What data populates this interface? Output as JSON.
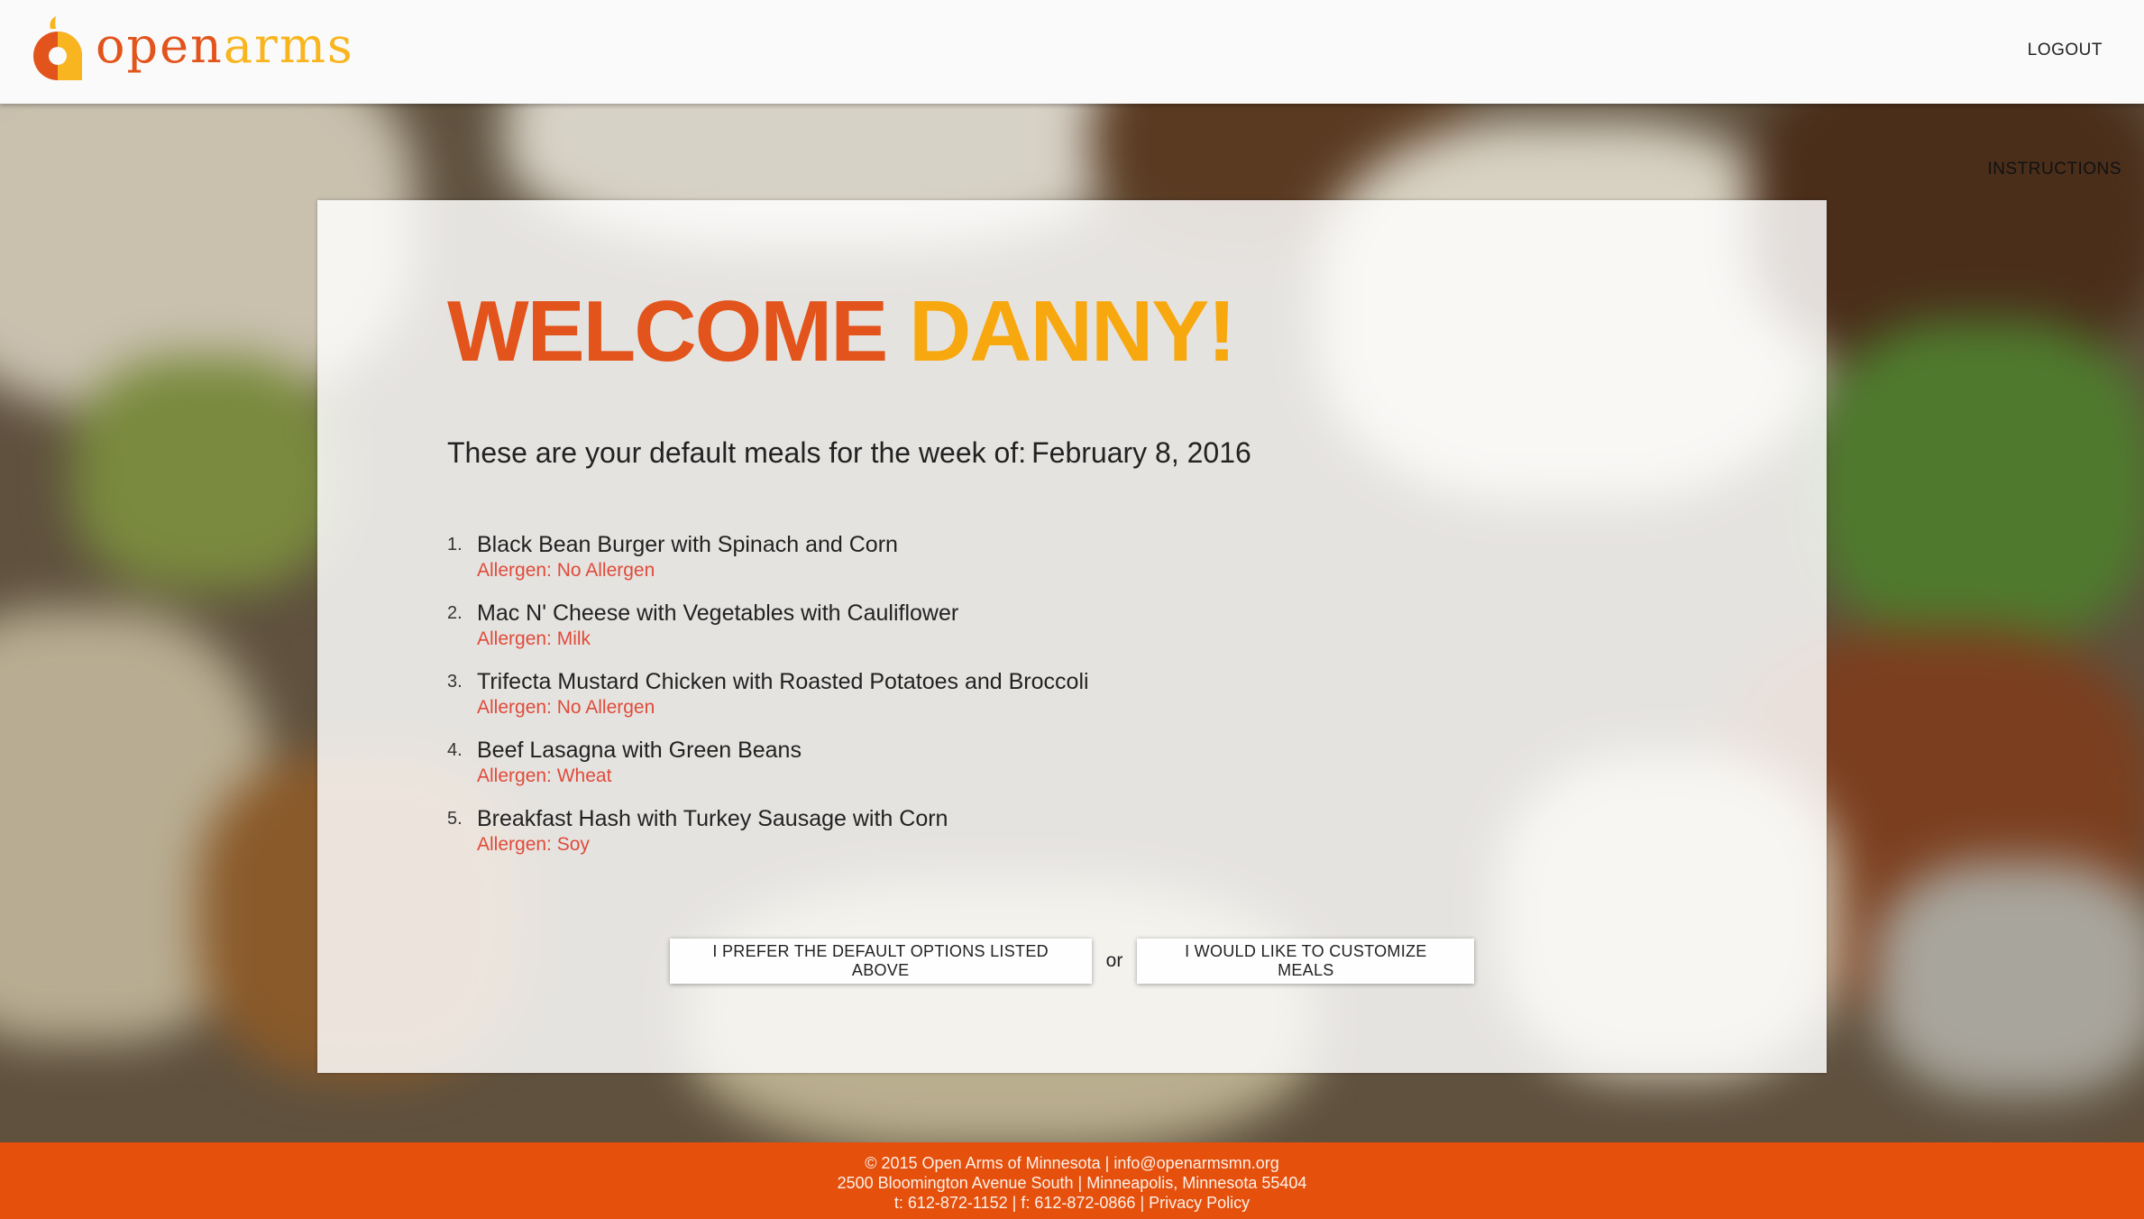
{
  "header": {
    "logo": {
      "open": "open",
      "arms": "arms",
      "icon": "apple-a-logo-icon"
    },
    "logout_label": "LOGOUT"
  },
  "instructions_label": "INSTRUCTIONS",
  "welcome": {
    "word": "WELCOME",
    "name": "DANNY!",
    "colors": {
      "word": "#e2541c",
      "name": "#f8a80f"
    }
  },
  "week": {
    "label": "These are your default meals for the week of:",
    "date": "February 8, 2016"
  },
  "meals": [
    {
      "num": "1.",
      "name": "Black Bean Burger with Spinach and Corn",
      "allergen": "Allergen: No Allergen"
    },
    {
      "num": "2.",
      "name": "Mac N' Cheese with Vegetables with Cauliflower",
      "allergen": "Allergen: Milk"
    },
    {
      "num": "3.",
      "name": "Trifecta Mustard Chicken with Roasted Potatoes and Broccoli",
      "allergen": "Allergen: No Allergen"
    },
    {
      "num": "4.",
      "name": "Beef Lasagna with Green Beans",
      "allergen": "Allergen: Wheat"
    },
    {
      "num": "5.",
      "name": "Breakfast Hash with Turkey Sausage with Corn",
      "allergen": "Allergen: Soy"
    }
  ],
  "actions": {
    "default_label": "I PREFER THE DEFAULT OPTIONS LISTED ABOVE",
    "or_label": "or",
    "customize_label": "I WOULD LIKE TO CUSTOMIZE MEALS"
  },
  "footer": {
    "line1_copyright": "© 2015 Open Arms of Minnesota",
    "line1_email": "info@openarmsmn.org",
    "line2_address": "2500 Bloomington Avenue South",
    "line2_city": "Minneapolis, Minnesota 55404",
    "line3_phone": "t: 612-872-1152",
    "line3_fax": "f: 612-872-0866",
    "line3_privacy": "Privacy Policy",
    "separator": "|"
  },
  "colors": {
    "brand_orange": "#e2541c",
    "brand_yellow": "#f8b51f",
    "footer_bg": "#e5500d",
    "allergen_red": "#e04b3a"
  }
}
